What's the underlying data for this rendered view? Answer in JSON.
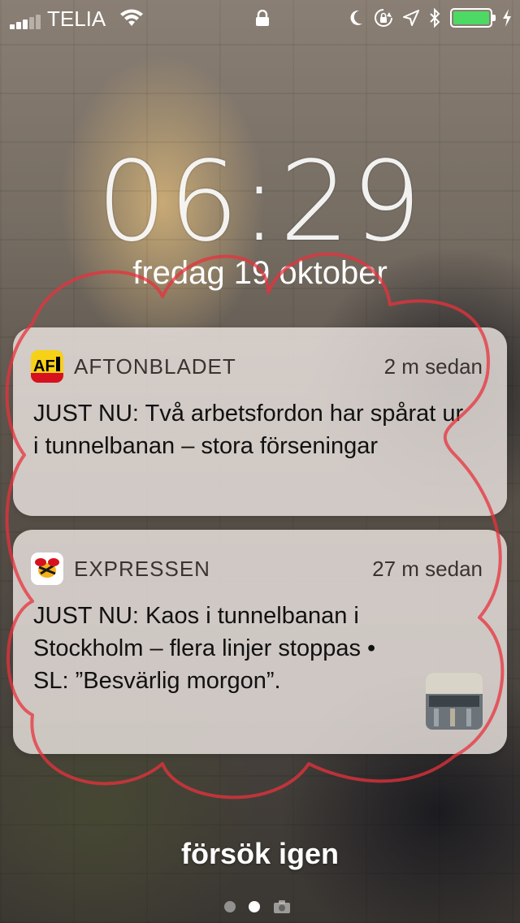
{
  "status_bar": {
    "carrier": "TELIA",
    "signal_bars_filled": 3,
    "signal_bars_total": 5,
    "battery_level": 1.0,
    "icons": [
      "wifi-icon",
      "lock-icon",
      "moon-icon",
      "rotation-lock-icon",
      "location-icon",
      "bluetooth-icon",
      "battery-icon",
      "charging-icon"
    ]
  },
  "lock_screen": {
    "time": "06:29",
    "date": "fredag 19 oktober"
  },
  "notifications": [
    {
      "app": "AFTONBLADET",
      "icon": "aftonbladet-app-icon",
      "time": "2 m sedan",
      "message": "JUST NU: Två arbetsfordon har spårat ur i tunnelbanan – stora förseningar"
    },
    {
      "app": "EXPRESSEN",
      "icon": "expressen-app-icon",
      "time": "27 m sedan",
      "message": "JUST NU: Kaos i tunnelbanan i Stockholm – flera linjer stoppas • SL: ”Besvärlig morgon”.",
      "has_thumbnail": true
    }
  ],
  "footer": {
    "retry_label": "försök igen",
    "pages": 3,
    "active_page": 2
  },
  "colors": {
    "battery": "#4cd964",
    "scribble": "#e8323c",
    "aftonbladet_yellow": "#f7d117",
    "aftonbladet_red": "#d6121f"
  }
}
